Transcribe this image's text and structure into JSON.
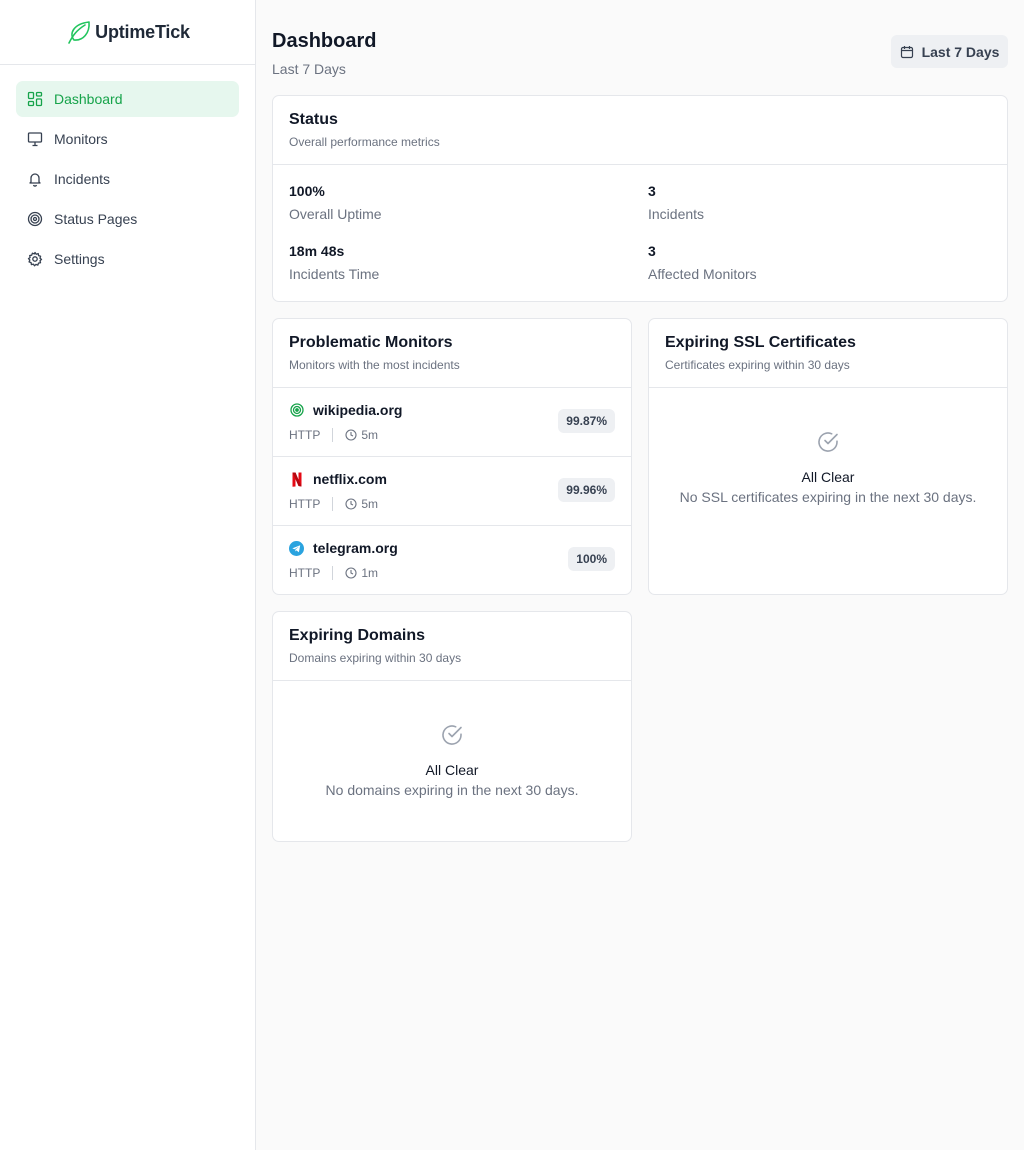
{
  "brand": {
    "name": "UptimeTick",
    "accent": "#22c55e"
  },
  "sidebar": {
    "items": [
      {
        "label": "Dashboard",
        "icon": "dashboard-icon",
        "active": true
      },
      {
        "label": "Monitors",
        "icon": "monitor-icon"
      },
      {
        "label": "Incidents",
        "icon": "bell-icon"
      },
      {
        "label": "Status Pages",
        "icon": "target-icon"
      },
      {
        "label": "Settings",
        "icon": "gear-icon"
      }
    ]
  },
  "header": {
    "title": "Dashboard",
    "subtitle": "Last 7 Days",
    "range_button": "Last 7 Days"
  },
  "status": {
    "title": "Status",
    "description": "Overall performance metrics",
    "metrics": [
      {
        "value": "100%",
        "label": "Overall Uptime"
      },
      {
        "value": "3",
        "label": "Incidents"
      },
      {
        "value": "18m 48s",
        "label": "Incidents Time"
      },
      {
        "value": "3",
        "label": "Affected Monitors"
      }
    ]
  },
  "problematic": {
    "title": "Problematic Monitors",
    "description": "Monitors with the most incidents",
    "monitors": [
      {
        "name": "wikipedia.org",
        "type": "HTTP",
        "interval": "5m",
        "uptime": "99.87%",
        "icon": "target-icon"
      },
      {
        "name": "netflix.com",
        "type": "HTTP",
        "interval": "5m",
        "uptime": "99.96%",
        "icon": "netflix-icon"
      },
      {
        "name": "telegram.org",
        "type": "HTTP",
        "interval": "1m",
        "uptime": "100%",
        "icon": "telegram-icon"
      }
    ]
  },
  "ssl": {
    "title": "Expiring SSL Certificates",
    "description": "Certificates expiring within 30 days",
    "empty_title": "All Clear",
    "empty_text": "No SSL certificates expiring in the next 30 days."
  },
  "domains": {
    "title": "Expiring Domains",
    "description": "Domains expiring within 30 days",
    "empty_title": "All Clear",
    "empty_text": "No domains expiring in the next 30 days."
  }
}
